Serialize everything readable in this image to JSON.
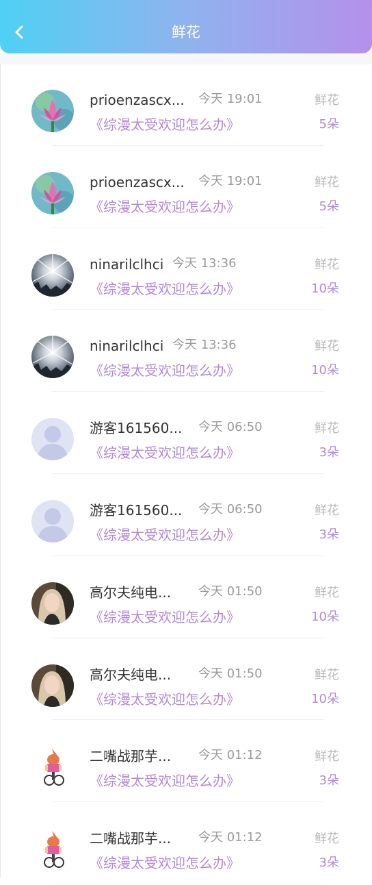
{
  "header": {
    "title": "鲜花",
    "back_icon": "chevron-left-icon",
    "gradient_colors": [
      "#4fd0f4",
      "#b590ec"
    ]
  },
  "items": [
    {
      "name": "prioenzascx...",
      "time": "今天 19:01",
      "book": "《综漫太受欢迎怎么办》",
      "type": "鲜花",
      "count": "5朵",
      "avatar": "lotus-avatar"
    },
    {
      "name": "prioenzascx...",
      "time": "今天 19:01",
      "book": "《综漫太受欢迎怎么办》",
      "type": "鲜花",
      "count": "5朵",
      "avatar": "lotus-avatar"
    },
    {
      "name": "ninarilclhci",
      "time": "今天 13:36",
      "book": "《综漫太受欢迎怎么办》",
      "type": "鲜花",
      "count": "10朵",
      "avatar": "sunburst-avatar"
    },
    {
      "name": "ninarilclhci",
      "time": "今天 13:36",
      "book": "《综漫太受欢迎怎么办》",
      "type": "鲜花",
      "count": "10朵",
      "avatar": "sunburst-avatar"
    },
    {
      "name": "游客161560...",
      "time": "今天 06:50",
      "book": "《综漫太受欢迎怎么办》",
      "type": "鲜花",
      "count": "3朵",
      "avatar": "default-avatar"
    },
    {
      "name": "游客161560...",
      "time": "今天 06:50",
      "book": "《综漫太受欢迎怎么办》",
      "type": "鲜花",
      "count": "3朵",
      "avatar": "default-avatar"
    },
    {
      "name": "高尔夫纯电...",
      "time": "今天 01:50",
      "book": "《综漫太受欢迎怎么办》",
      "type": "鲜花",
      "count": "10朵",
      "avatar": "portrait-avatar"
    },
    {
      "name": "高尔夫纯电...",
      "time": "今天 01:50",
      "book": "《综漫太受欢迎怎么办》",
      "type": "鲜花",
      "count": "10朵",
      "avatar": "portrait-avatar"
    },
    {
      "name": "二嘴战那芋...",
      "time": "今天 01:12",
      "book": "《综漫太受欢迎怎么办》",
      "type": "鲜花",
      "count": "3朵",
      "avatar": "cartoon-avatar"
    },
    {
      "name": "二嘴战那芋...",
      "time": "今天 01:12",
      "book": "《综漫太受欢迎怎么办》",
      "type": "鲜花",
      "count": "3朵",
      "avatar": "cartoon-avatar"
    }
  ]
}
